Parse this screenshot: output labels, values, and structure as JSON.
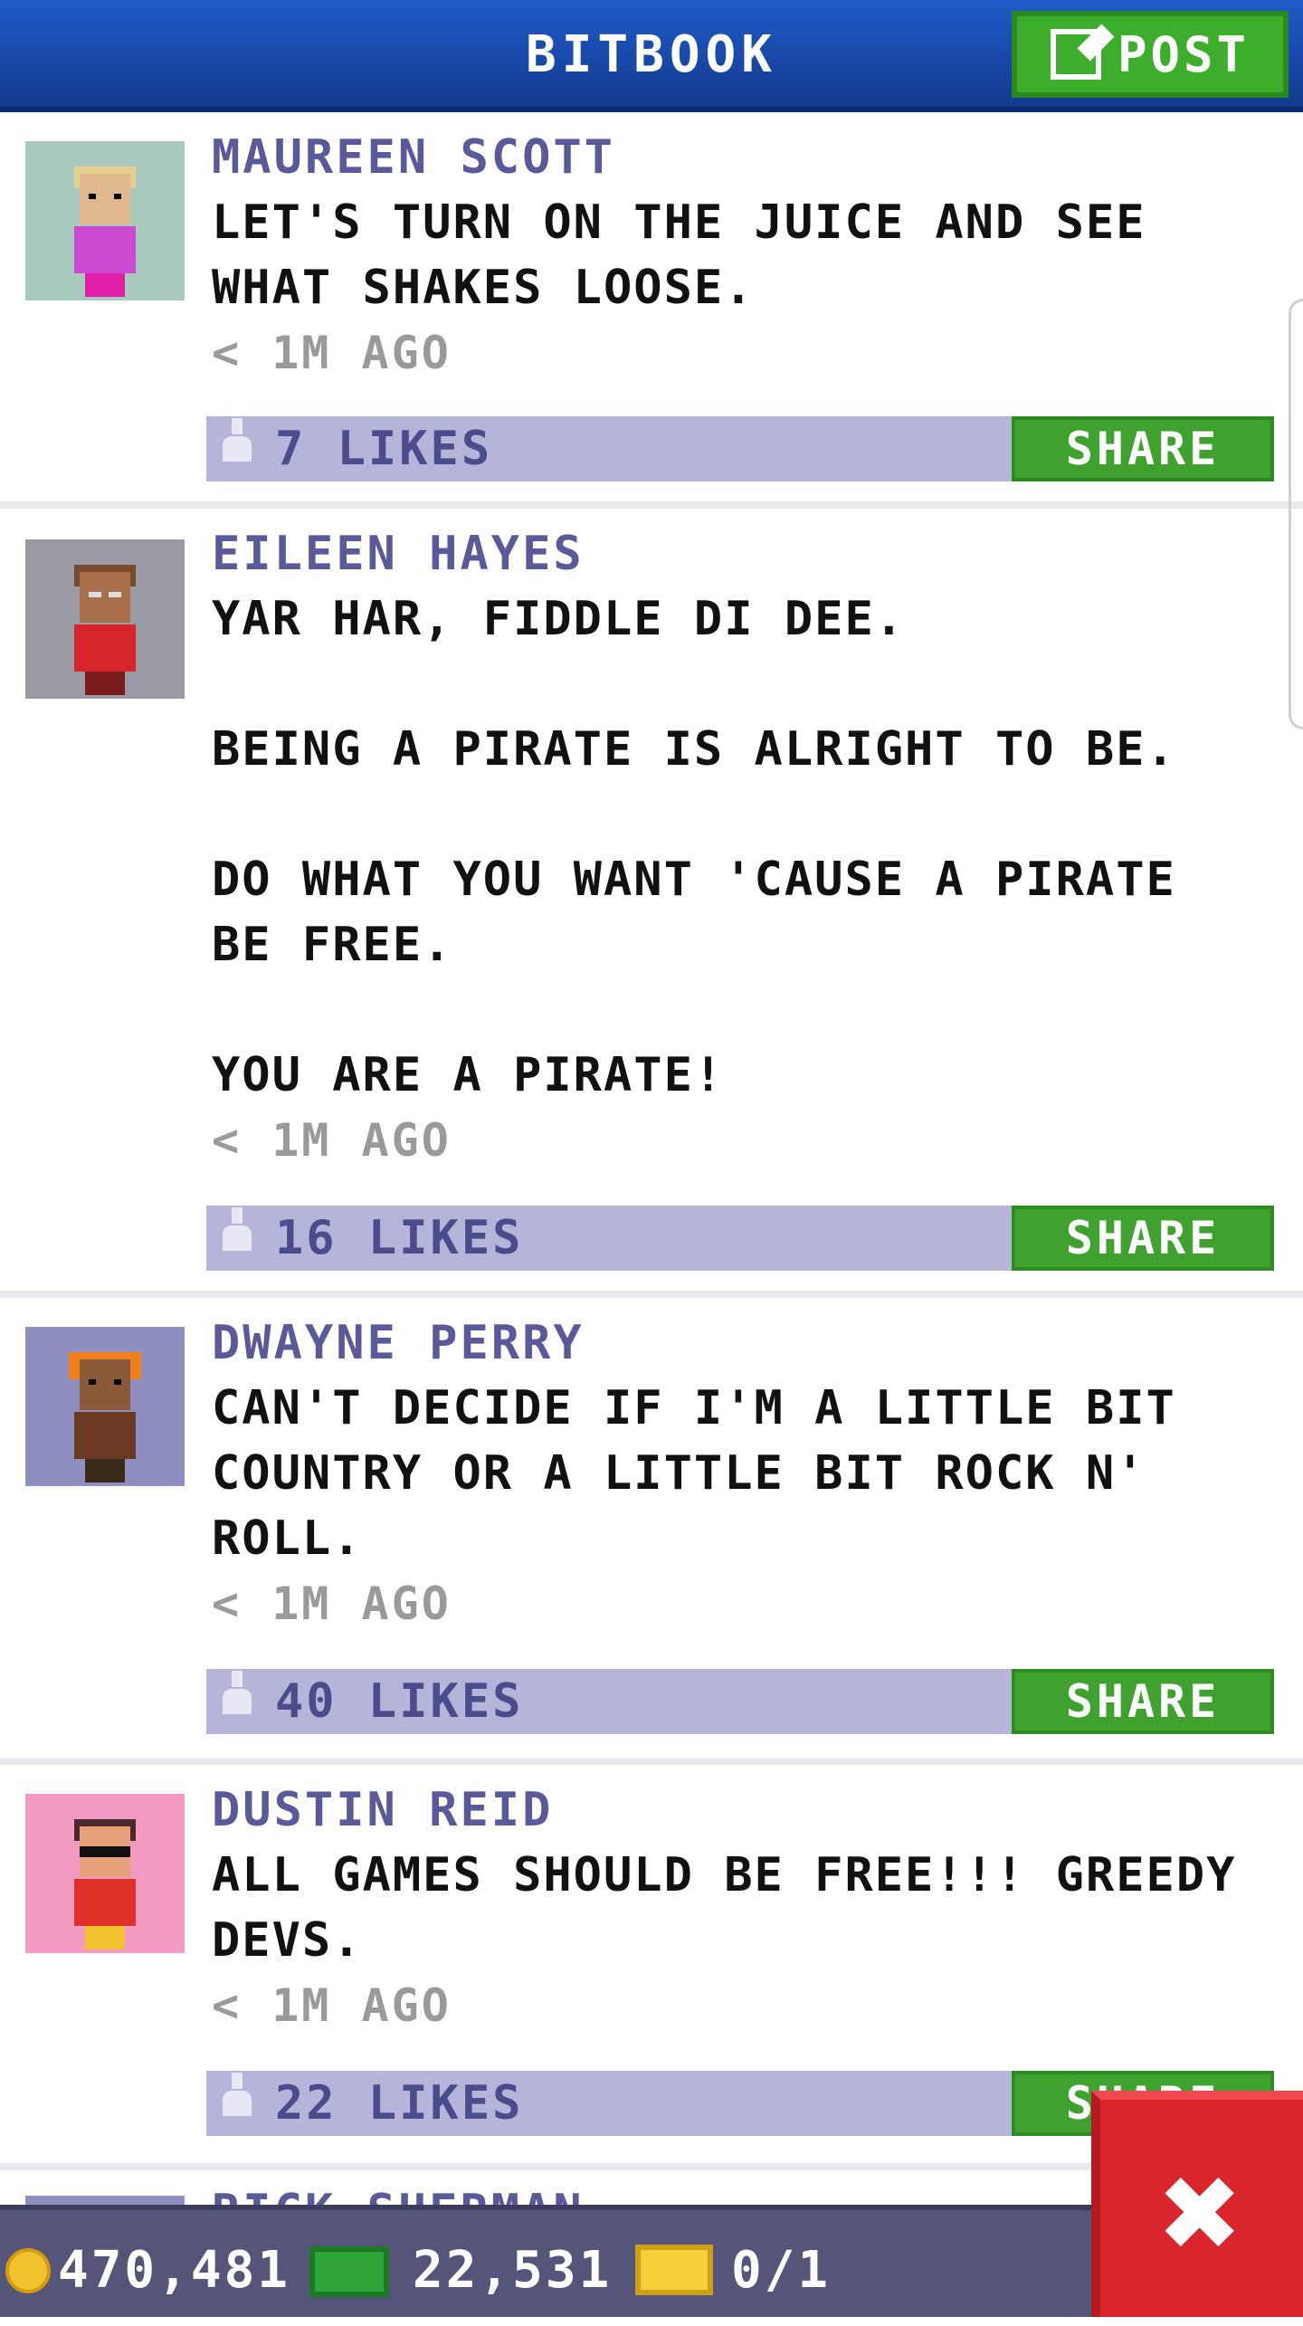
{
  "header": {
    "title": "BITBOOK",
    "post_label": "POST"
  },
  "posts": [
    {
      "name": "MAUREEN SCOTT",
      "message": "LET'S TURN ON THE JUICE AND SEE\nWHAT SHAKES LOOSE.",
      "time": "< 1M AGO",
      "likes": "7 LIKES",
      "share_label": "SHARE",
      "avatar_bg": "#a9c9be"
    },
    {
      "name": "EILEEN HAYES",
      "message": "YAR HAR, FIDDLE DI DEE.\n\nBEING A PIRATE IS ALRIGHT TO BE.\n\nDO WHAT YOU WANT 'CAUSE A PIRATE\nBE FREE.\n\nYOU ARE A PIRATE!",
      "time": "< 1M AGO",
      "likes": "16 LIKES",
      "share_label": "SHARE",
      "avatar_bg": "#9a9aa4"
    },
    {
      "name": "DWAYNE PERRY",
      "message": "CAN'T DECIDE IF I'M A LITTLE BIT\nCOUNTRY OR A LITTLE BIT ROCK N'\nROLL.",
      "time": "< 1M AGO",
      "likes": "40 LIKES",
      "share_label": "SHARE",
      "avatar_bg": "#8f8fbf"
    },
    {
      "name": "DUSTIN REID",
      "message": "ALL GAMES SHOULD BE FREE!!! GREEDY\nDEVS.",
      "time": "< 1M AGO",
      "likes": "22 LIKES",
      "share_label": "SHARE",
      "avatar_bg": "#f29ac2"
    },
    {
      "name": "RICK SHERMAN",
      "avatar_bg": "#8f8fbf"
    }
  ],
  "footer": {
    "coins": "470,481",
    "bux": "22,531",
    "tickets": "0/1"
  },
  "colors": {
    "header_blue": "#1a4fb5",
    "post_green": "#3cae2c",
    "name_color": "#5a5a9a",
    "likebar": "#b4b5d8",
    "close_red": "#d9252b"
  },
  "icons": [
    "compose-icon",
    "like-icon",
    "coin-icon",
    "bux-icon",
    "ticket-icon",
    "close-icon"
  ]
}
